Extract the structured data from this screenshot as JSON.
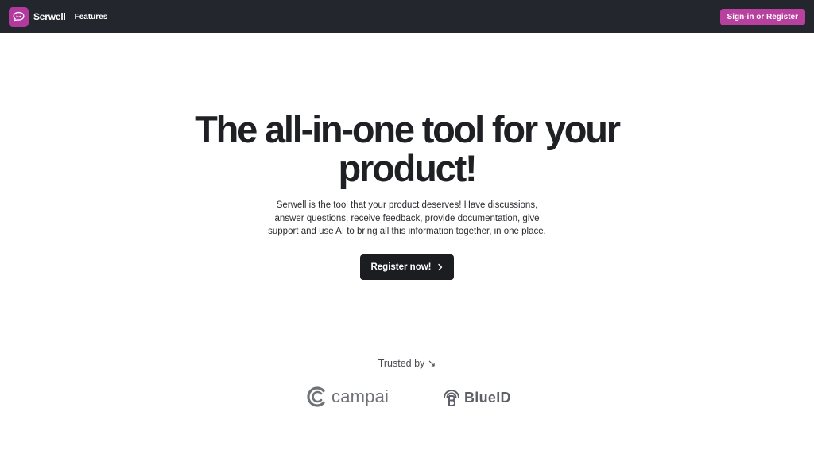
{
  "nav": {
    "brand": "Serwell",
    "features_label": "Features",
    "signin_label": "Sign-in or Register",
    "accent_color": "#b8409f"
  },
  "hero": {
    "title_lines": [
      "The all-in-one tool for your",
      "product!"
    ],
    "subtitle_lines": [
      "Serwell is the tool that your product deserves! Have discussions,",
      "answer questions, receive feedback, provide documentation, give",
      "support and use AI to bring all this information together, in one place."
    ],
    "cta_label": "Register now!",
    "cta_icon": "chevron-right-icon"
  },
  "trusted": {
    "label": "Trusted by ↘",
    "logos": [
      {
        "name": "campai",
        "icon": "campai-logo-icon"
      },
      {
        "name": "BlueID",
        "icon": "blueid-logo-icon"
      }
    ]
  }
}
